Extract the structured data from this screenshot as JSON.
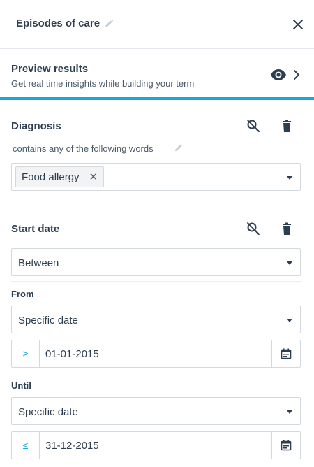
{
  "header": {
    "title": "Episodes of care"
  },
  "preview": {
    "title": "Preview results",
    "subtitle": "Get real time insights while building your term"
  },
  "diagnosis": {
    "title": "Diagnosis",
    "condition": "contains any of the following words",
    "tags": [
      {
        "label": "Food allergy",
        "remove": "✕"
      }
    ]
  },
  "start_date": {
    "title": "Start date",
    "operator": "Between",
    "from": {
      "label": "From",
      "type": "Specific date",
      "prefix": "≥",
      "value": "01-01-2015"
    },
    "until": {
      "label": "Until",
      "type": "Specific date",
      "prefix": "≤",
      "value": "31-12-2015"
    }
  },
  "colors": {
    "accent": "#1aa7dc",
    "text": "#2c3e50",
    "border": "#d4d9de"
  }
}
